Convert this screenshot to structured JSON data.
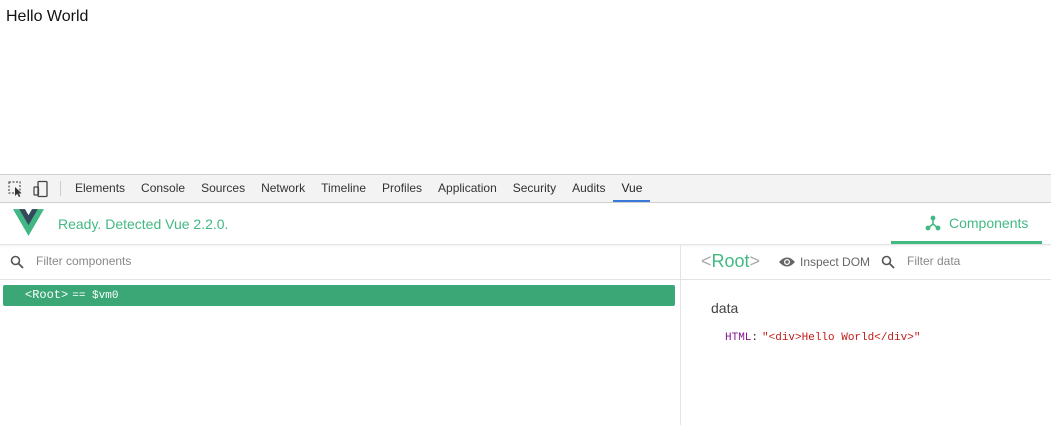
{
  "page": {
    "text": "Hello World"
  },
  "devtools": {
    "tabs": [
      "Elements",
      "Console",
      "Sources",
      "Network",
      "Timeline",
      "Profiles",
      "Application",
      "Security",
      "Audits",
      "Vue"
    ],
    "active_tab": "Vue"
  },
  "vue": {
    "status": "Ready. Detected Vue 2.2.0.",
    "components_tab": "Components",
    "filter_components_placeholder": "Filter components",
    "tree": [
      {
        "name": "<Root>",
        "vm": "== $vm0",
        "selected": true
      }
    ],
    "inspector": {
      "title": "Root",
      "inspect_dom": "Inspect DOM",
      "filter_data_placeholder": "Filter data",
      "section": "data",
      "fields": [
        {
          "key": "HTML",
          "value": "\"<div>Hello World</div>\""
        }
      ]
    }
  },
  "colors": {
    "vue_green": "#42b983",
    "selected_row": "#3ba776",
    "active_tab_underline": "#3879d9"
  },
  "icons": [
    "select-element-icon",
    "device-toggle-icon",
    "vue-logo-icon",
    "components-icon",
    "search-icon",
    "eye-icon"
  ]
}
